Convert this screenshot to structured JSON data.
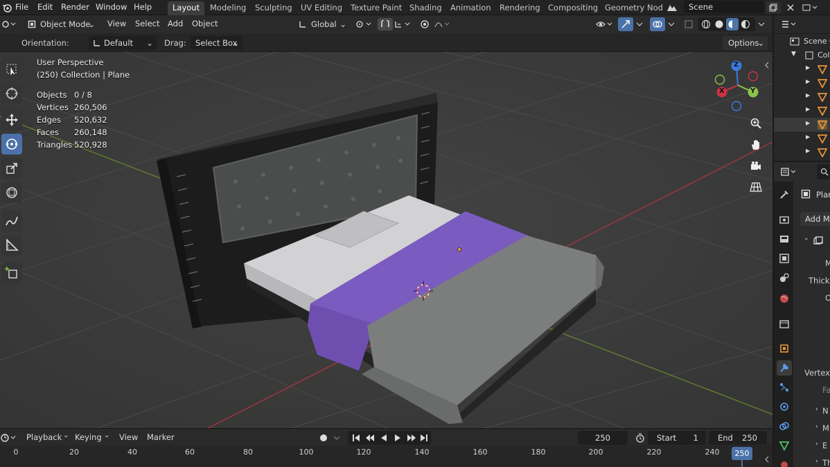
{
  "menu": {
    "items": [
      "File",
      "Edit",
      "Render",
      "Window",
      "Help"
    ]
  },
  "workspaces": [
    "Layout",
    "Modeling",
    "Sculpting",
    "UV Editing",
    "Texture Paint",
    "Shading",
    "Animation",
    "Rendering",
    "Compositing",
    "Geometry Nod"
  ],
  "scene": {
    "name": "Scene"
  },
  "header": {
    "mode": "Object Mode",
    "menus": [
      "View",
      "Select",
      "Add",
      "Object"
    ],
    "transform_orientation": "Global"
  },
  "tool_settings": {
    "orientation_label": "Orientation:",
    "orientation_value": "Default",
    "drag_label": "Drag:",
    "drag_value": "Select Box",
    "options_label": "Options"
  },
  "overlay": {
    "view_name": "User Perspective",
    "collection_line": "(250) Collection | Plane",
    "stats": [
      {
        "label": "Objects",
        "value": "0 / 8"
      },
      {
        "label": "Vertices",
        "value": "260,506"
      },
      {
        "label": "Edges",
        "value": "520,632"
      },
      {
        "label": "Faces",
        "value": "260,148"
      },
      {
        "label": "Triangles",
        "value": "520,928"
      }
    ]
  },
  "gizmo": {
    "x": "X",
    "y": "Y",
    "z": "Z"
  },
  "outliner": {
    "scene_label": "Scene C",
    "collection_label": "Coll"
  },
  "properties": {
    "object_name": "Plan",
    "add_modifier": "Add Mo",
    "row_m": "M",
    "row_thickness": "Thickn",
    "row_o": "O",
    "row_vertex": "Vertex",
    "row_fa": "Fa",
    "row_n": "N",
    "row_ma": "M",
    "row_e": "E",
    "row_th": "Th"
  },
  "timeline": {
    "menus": [
      "Playback",
      "Keying",
      "View",
      "Marker"
    ],
    "current_frame": "250",
    "start_label": "Start",
    "start_value": "1",
    "end_label": "End",
    "end_value": "250",
    "ruler_ticks": [
      "0",
      "20",
      "40",
      "60",
      "80",
      "100",
      "120",
      "140",
      "160",
      "180",
      "200",
      "220",
      "240"
    ],
    "playhead_label": "250"
  },
  "colors": {
    "accent": "#4b72a8",
    "x_axis": "#cc3344",
    "y_axis": "#8bc34a",
    "z_axis": "#3b7be0",
    "bed_sheet": "#7a5bc0"
  }
}
